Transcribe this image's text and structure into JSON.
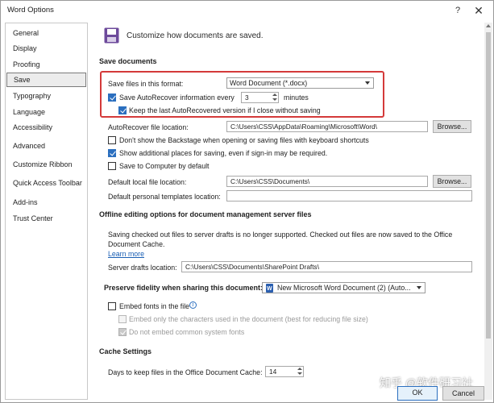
{
  "window": {
    "title": "Word Options",
    "help_glyph": "?",
    "close_glyph": "✕"
  },
  "sidebar": {
    "items": [
      {
        "label": "General"
      },
      {
        "label": "Display"
      },
      {
        "label": "Proofing"
      },
      {
        "label": "Save",
        "active": true
      },
      {
        "label": "Typography"
      },
      {
        "label": "Language"
      },
      {
        "label": "Accessibility"
      },
      {
        "label": "Advanced"
      },
      {
        "label": "Customize Ribbon"
      },
      {
        "label": "Quick Access Toolbar"
      },
      {
        "label": "Add-ins"
      },
      {
        "label": "Trust Center"
      }
    ]
  },
  "header": {
    "text": "Customize how documents are saved.",
    "icon": "floppy-disk-icon"
  },
  "save_documents": {
    "title": "Save documents",
    "format_label": "Save files in this format:",
    "format_value": "Word Document (*.docx)",
    "autorecover_label": "Save AutoRecover information every",
    "autorecover_checked": true,
    "autorecover_minutes": "3",
    "minutes_label": "minutes",
    "keep_last_label": "Keep the last AutoRecovered version if I close without saving",
    "keep_last_checked": true,
    "autorecover_location_label": "AutoRecover file location:",
    "autorecover_location_value": "C:\\Users\\CSS\\AppData\\Roaming\\Microsoft\\Word\\",
    "browse_label": "Browse...",
    "dont_show_backstage_label": "Don't show the Backstage when opening or saving files with keyboard shortcuts",
    "dont_show_backstage_checked": false,
    "show_additional_places_label": "Show additional places for saving, even if sign-in may be required.",
    "show_additional_places_checked": true,
    "save_to_computer_label": "Save to Computer by default",
    "save_to_computer_checked": false,
    "default_local_label": "Default local file location:",
    "default_local_value": "C:\\Users\\CSS\\Documents\\",
    "default_templates_label": "Default personal templates location:",
    "default_templates_value": ""
  },
  "offline": {
    "title": "Offline editing options for document management server files",
    "desc_line1": "Saving checked out files to server drafts is no longer supported. Checked out files are now saved to the Office",
    "desc_line2": "Document Cache.",
    "learn_more": "Learn more",
    "server_drafts_label": "Server drafts location:",
    "server_drafts_value": "C:\\Users\\CSS\\Documents\\SharePoint Drafts\\"
  },
  "fidelity": {
    "label": "Preserve fidelity when sharing this document:",
    "doc_value": "New Microsoft Word Document (2) (Auto...",
    "embed_fonts_label": "Embed fonts in the file",
    "embed_fonts_checked": false,
    "embed_only_label": "Embed only the characters used in the document (best for reducing file size)",
    "embed_only_checked": false,
    "no_common_label": "Do not embed common system fonts",
    "no_common_checked": true
  },
  "cache": {
    "title": "Cache Settings",
    "days_label": "Days to keep files in the Office Document Cache:",
    "days_value": "14"
  },
  "footer": {
    "ok": "OK",
    "cancel": "Cancel",
    "watermark": "知乎 @软件研习社"
  }
}
